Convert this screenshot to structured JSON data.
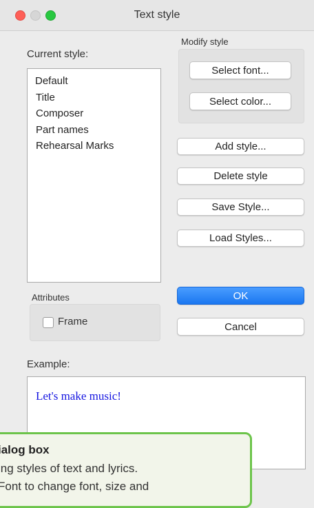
{
  "window": {
    "title": "Text style"
  },
  "current_style": {
    "label": "Current style:",
    "items": [
      "Default",
      "Title",
      "Composer",
      "Part names",
      "Rehearsal Marks"
    ]
  },
  "modify_style": {
    "label": "Modify style",
    "select_font": "Select font...",
    "select_color": "Select color..."
  },
  "buttons": {
    "add_style": "Add style...",
    "delete_style": "Delete style",
    "save_style": "Save Style...",
    "load_styles": "Load Styles...",
    "ok": "OK",
    "cancel": "Cancel"
  },
  "attributes": {
    "label": "Attributes",
    "frame": "Frame",
    "frame_checked": false
  },
  "example": {
    "label": "Example:",
    "text": "Let's make music!",
    "text_color": "#1414e0"
  },
  "callout": {
    "title": "ialog box",
    "line1": "ing styles of text and lyrics.",
    "line2": "Font to change font, size and",
    "border_color": "#6cc44a"
  },
  "colors": {
    "accent": "#1a77f0",
    "close": "#fe5f57",
    "maximize": "#28c840"
  }
}
